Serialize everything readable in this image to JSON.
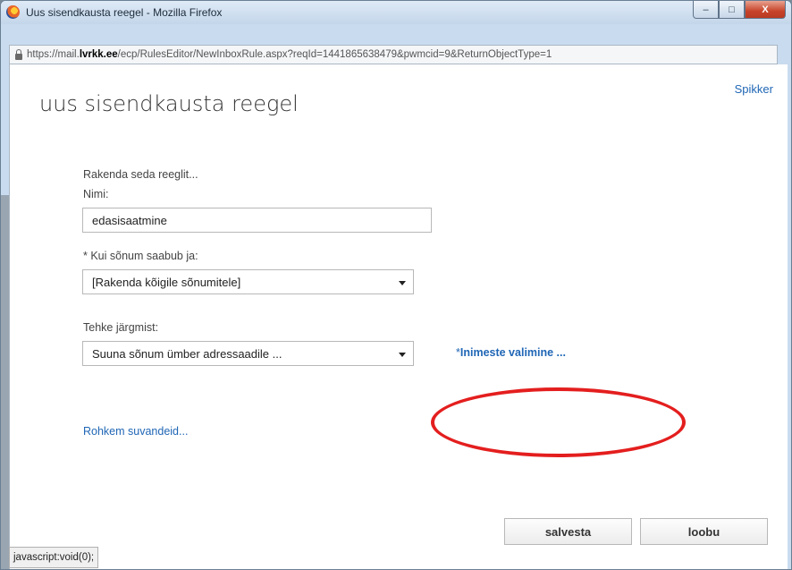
{
  "window": {
    "title": "Uus sisendkausta reegel - Mozilla Firefox",
    "url_prefix": "https://mail.",
    "url_host": "lvrkk.ee",
    "url_rest": "/ecp/RulesEditor/NewInboxRule.aspx?reqId=1441865638479&pwmcid=9&ReturnObjectType=1",
    "buttons": {
      "minimize": "–",
      "maximize": "□",
      "close": "X"
    }
  },
  "page": {
    "title": "uus sisendkausta reegel",
    "help_link": "Spikker"
  },
  "form": {
    "intro": "Rakenda seda reeglit...",
    "name_label": "Nimi:",
    "name_value": "edasisaatmine",
    "condition_label": "* Kui sõnum saabub ja:",
    "condition_value": "[Rakenda kõigile sõnumitele]",
    "action_label": "Tehke järgmist:",
    "action_value": "Suuna sõnum ümber adressaadile ...",
    "people_link_star": "*",
    "people_link": "Inimeste valimine ...",
    "more_options": "Rohkem suvandeid..."
  },
  "actions": {
    "save": "salvesta",
    "cancel": "loobu"
  },
  "status_bar": "javascript:void(0);",
  "colors": {
    "link": "#1f66b5",
    "highlight": "#e41e1e"
  }
}
